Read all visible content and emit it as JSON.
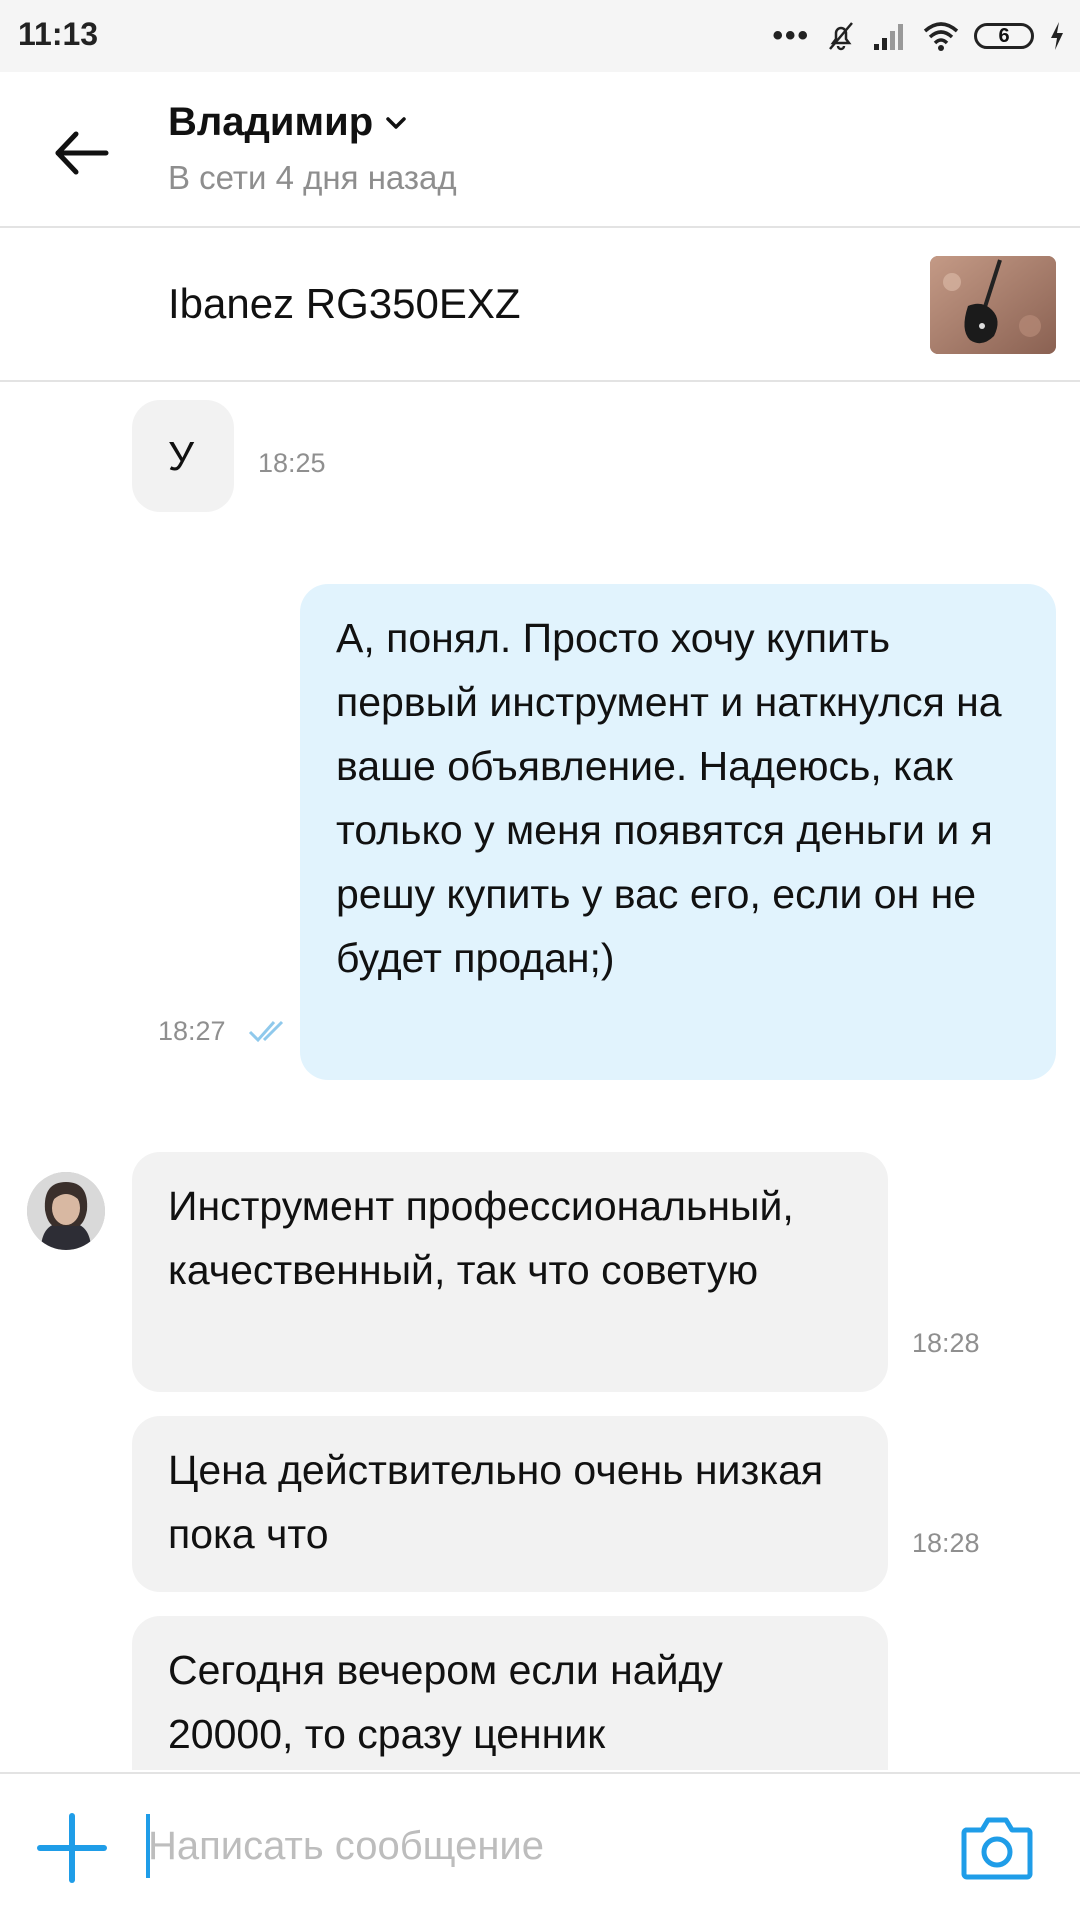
{
  "status_bar": {
    "time": "11:13",
    "battery": "6"
  },
  "header": {
    "name": "Владимир",
    "status": "В сети 4 дня назад"
  },
  "listing": {
    "title": "Ibanez RG350EXZ"
  },
  "messages": [
    {
      "direction": "in",
      "text": "У",
      "time": "18:25"
    },
    {
      "direction": "out",
      "text": "А, понял. Просто хочу купить первый инструмент и наткнулся на ваше объявление. Надеюсь, как только у меня появятся деньги и я решу купить у вас его, если он не будет продан;)",
      "time": "18:27",
      "read": true
    },
    {
      "direction": "in",
      "text": "Инструмент профессиональный, качественный, так что советую",
      "time": "18:28"
    },
    {
      "direction": "in",
      "text": "Цена действительно очень низкая пока что",
      "time": "18:28"
    },
    {
      "direction": "in",
      "text": "Сегодня вечером если найду 20000, то сразу ценник",
      "time": ""
    }
  ],
  "input": {
    "placeholder": "Написать сообщение"
  },
  "colors": {
    "accent": "#1f9de8",
    "incoming_bubble": "#f2f2f2",
    "outgoing_bubble": "#e1f3fd",
    "read_check": "#8fc9ec"
  },
  "icons": [
    "back-arrow-icon",
    "chevron-down-icon",
    "plus-icon",
    "camera-icon",
    "double-check-icon",
    "wifi-icon",
    "signal-icon",
    "mute-icon",
    "battery-icon",
    "charging-icon"
  ]
}
